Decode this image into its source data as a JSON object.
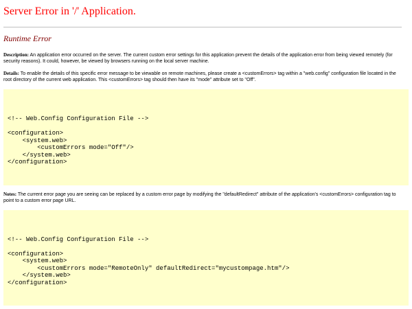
{
  "page": {
    "title": "Server Error in '/' Application.",
    "subtitle": "Runtime Error"
  },
  "description": {
    "label": "Description:",
    "text": " An application error occurred on the server. The current custom error settings for this application prevent the details of the application error from being viewed remotely (for security reasons). It could, however, be viewed by browsers running on the local server machine."
  },
  "details": {
    "label": "Details:",
    "text": " To enable the details of this specific error message to be viewable on remote machines, please create a <customErrors> tag within a \"web.config\" configuration file located in the root directory of the current web application. This <customErrors> tag should then have its \"mode\" attribute set to \"Off\"."
  },
  "code1": {
    "lines": [
      "<!-- Web.Config Configuration File -->",
      "",
      "<configuration>",
      "    <system.web>",
      "        <customErrors mode=\"Off\"/>",
      "    </system.web>",
      "</configuration>"
    ]
  },
  "notes": {
    "label": "Notes:",
    "text": " The current error page you are seeing can be replaced by a custom error page by modifying the \"defaultRedirect\" attribute of the application's <customErrors> configuration tag to point to a custom error page URL."
  },
  "code2": {
    "lines": [
      "<!-- Web.Config Configuration File -->",
      "",
      "<configuration>",
      "    <system.web>",
      "        <customErrors mode=\"RemoteOnly\" defaultRedirect=\"mycustompage.htm\"/>",
      "    </system.web>",
      "</configuration>"
    ]
  }
}
